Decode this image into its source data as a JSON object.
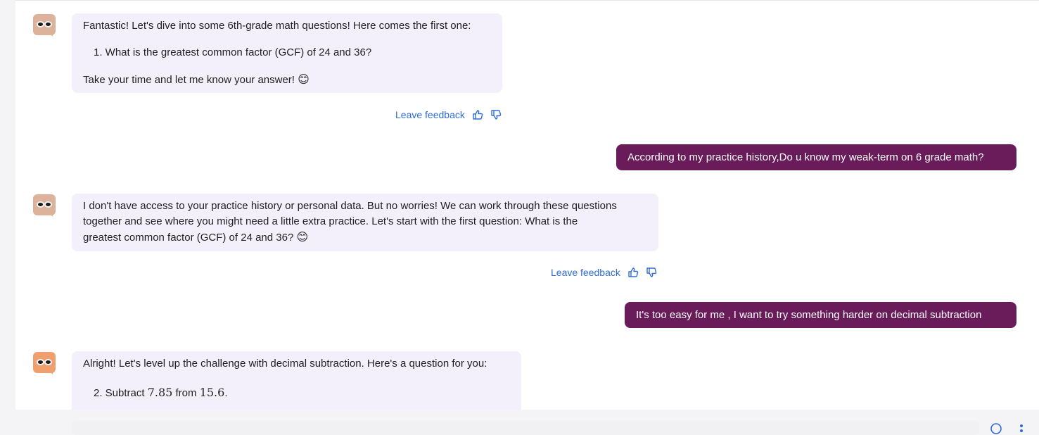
{
  "messages": [
    {
      "role": "bot",
      "intro": "Fantastic! Let's dive into some 6th-grade math questions! Here comes the first one:",
      "list_item": "1. What is the greatest common factor (GCF) of 24 and 36?",
      "outro": "Take your time and let me know your answer!",
      "emoji": "😊",
      "feedback_label": "Leave feedback"
    },
    {
      "role": "user",
      "text": "According to my practice history,Do u know my weak-term on 6 grade math?"
    },
    {
      "role": "bot",
      "line1": "I don't have access to your practice history or personal data. But no worries! We can work through these questions",
      "line2": "together and see where you might need a little extra practice. Let's start with the first question: What is the",
      "line3": "greatest common factor (GCF) of 24 and 36?",
      "emoji": "😊",
      "feedback_label": "Leave feedback"
    },
    {
      "role": "user",
      "text": "It's too  easy for me , I want to try something harder on decimal subtraction"
    },
    {
      "role": "bot",
      "intro": "Alright! Let's level up the challenge with decimal subtraction. Here's a question for you:",
      "item_prefix": "2. Subtract",
      "value_a": "7.85",
      "item_mid": "from",
      "value_b": "15.6",
      "item_end": "."
    }
  ],
  "colors": {
    "user_bubble": "#6a1b5a",
    "bot_bubble": "#f3f0fc",
    "link": "#2f6bd8"
  },
  "icons": [
    "bot-avatar",
    "thumbs-up-icon",
    "thumbs-down-icon",
    "send-icon",
    "more-menu-icon"
  ]
}
